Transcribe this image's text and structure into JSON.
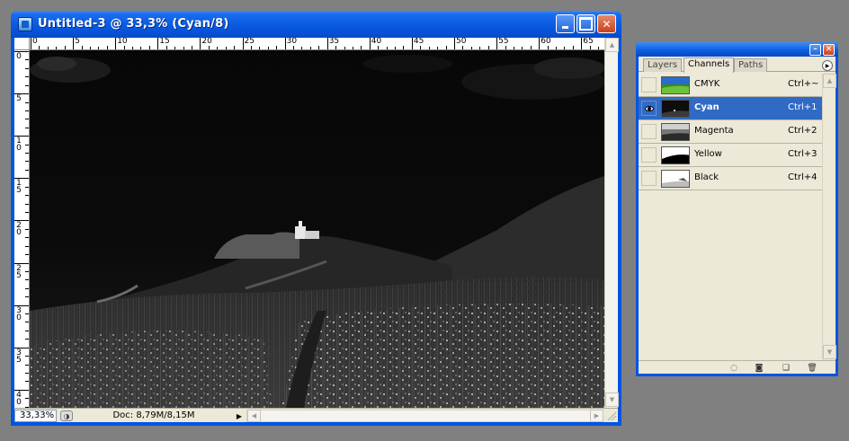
{
  "document_window": {
    "title": "Untitled-3 @ 33,3% (Cyan/8)",
    "ruler_h_labels": [
      "0",
      "5",
      "10",
      "15",
      "20",
      "25",
      "30",
      "35",
      "40",
      "45",
      "50",
      "55",
      "60",
      "65"
    ],
    "ruler_v_labels": [
      "0",
      "5",
      "1 0",
      "1 5",
      "2 0",
      "2 5",
      "3 0",
      "3 5",
      "4 0"
    ],
    "zoom": "33,33%",
    "doc_size": "Doc: 8,79M/8,15M",
    "titlebar_buttons": {
      "minimize": "minimize-icon",
      "maximize": "maximize-icon",
      "close": "close-icon"
    },
    "image_subject": "grayscale-landscape-photo"
  },
  "channels_palette": {
    "tabs": [
      "Layers",
      "Channels",
      "Paths"
    ],
    "active_tab": "Channels",
    "channels": [
      {
        "name": "CMYK",
        "shortcut": "Ctrl+~",
        "visible": false,
        "selected": false,
        "thumb": "color"
      },
      {
        "name": "Cyan",
        "shortcut": "Ctrl+1",
        "visible": true,
        "selected": true,
        "thumb": "cyan"
      },
      {
        "name": "Magenta",
        "shortcut": "Ctrl+2",
        "visible": false,
        "selected": false,
        "thumb": "magenta"
      },
      {
        "name": "Yellow",
        "shortcut": "Ctrl+3",
        "visible": false,
        "selected": false,
        "thumb": "yellow"
      },
      {
        "name": "Black",
        "shortcut": "Ctrl+4",
        "visible": false,
        "selected": false,
        "thumb": "black"
      }
    ],
    "footer_icons": [
      "load-selection-icon",
      "save-selection-icon",
      "new-channel-icon",
      "trash-icon"
    ],
    "colors": {
      "selection": "#316ac5",
      "titlebar": "#0054e3",
      "panel": "#ece9d8"
    }
  }
}
